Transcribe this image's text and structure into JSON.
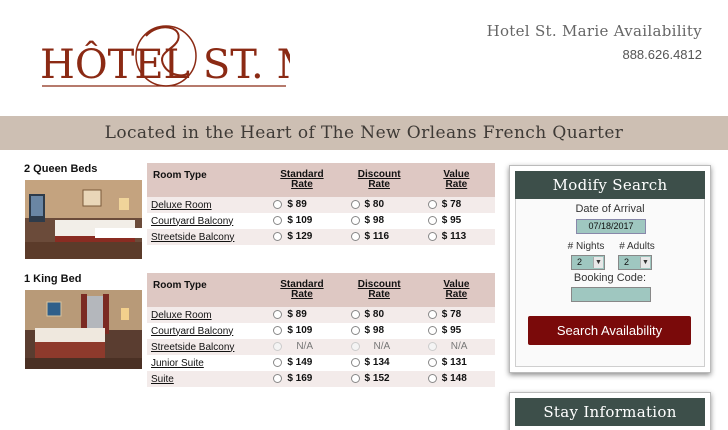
{
  "header": {
    "logo_text": "HÔTEL ST. MARIE",
    "hotel_name": "Hotel St. Marie Availability",
    "phone": "888.626.4812"
  },
  "band": {
    "tagline": "Located in the Heart of The New Orleans French Quarter"
  },
  "table_headers": {
    "room_type": "Room Type",
    "standard": [
      "Standard",
      "Rate"
    ],
    "discount": [
      "Discount",
      "Rate"
    ],
    "value": [
      "Value",
      "Rate"
    ]
  },
  "rooms": [
    {
      "title": "2 Queen Beds",
      "rows": [
        {
          "name": "Deluxe Room",
          "standard": "$  89",
          "discount": "$  80",
          "value": "$  78"
        },
        {
          "name": "Courtyard Balcony",
          "standard": "$ 109",
          "discount": "$  98",
          "value": "$  95"
        },
        {
          "name": "Streetside Balcony",
          "standard": "$ 129",
          "discount": "$ 116",
          "value": "$ 113"
        }
      ]
    },
    {
      "title": "1 King Bed",
      "rows": [
        {
          "name": "Deluxe Room",
          "standard": "$  89",
          "discount": "$  80",
          "value": "$  78"
        },
        {
          "name": "Courtyard Balcony",
          "standard": "$ 109",
          "discount": "$  98",
          "value": "$  95"
        },
        {
          "name": "Streetside Balcony",
          "standard": "N/A",
          "discount": "N/A",
          "value": "N/A"
        },
        {
          "name": "Junior Suite",
          "standard": "$ 149",
          "discount": "$ 134",
          "value": "$ 131"
        },
        {
          "name": "Suite",
          "standard": "$ 169",
          "discount": "$ 152",
          "value": "$ 148"
        }
      ]
    }
  ],
  "modify_search": {
    "title": "Modify Search",
    "arrival_label": "Date of Arrival",
    "arrival_value": "07/18/2017",
    "nights_label": "# Nights",
    "nights_value": "2",
    "adults_label": "# Adults",
    "adults_value": "2",
    "booking_code_label": "Booking Code:",
    "booking_code_value": "",
    "search_button": "Search Availability"
  },
  "stay_information": {
    "title": "Stay Information"
  },
  "colors": {
    "brand_red": "#8b2a14",
    "panel_green": "#3d4f4a",
    "button_red": "#7a0a0a",
    "input_teal": "#9fc7c0",
    "band": "#cdbfb3"
  }
}
